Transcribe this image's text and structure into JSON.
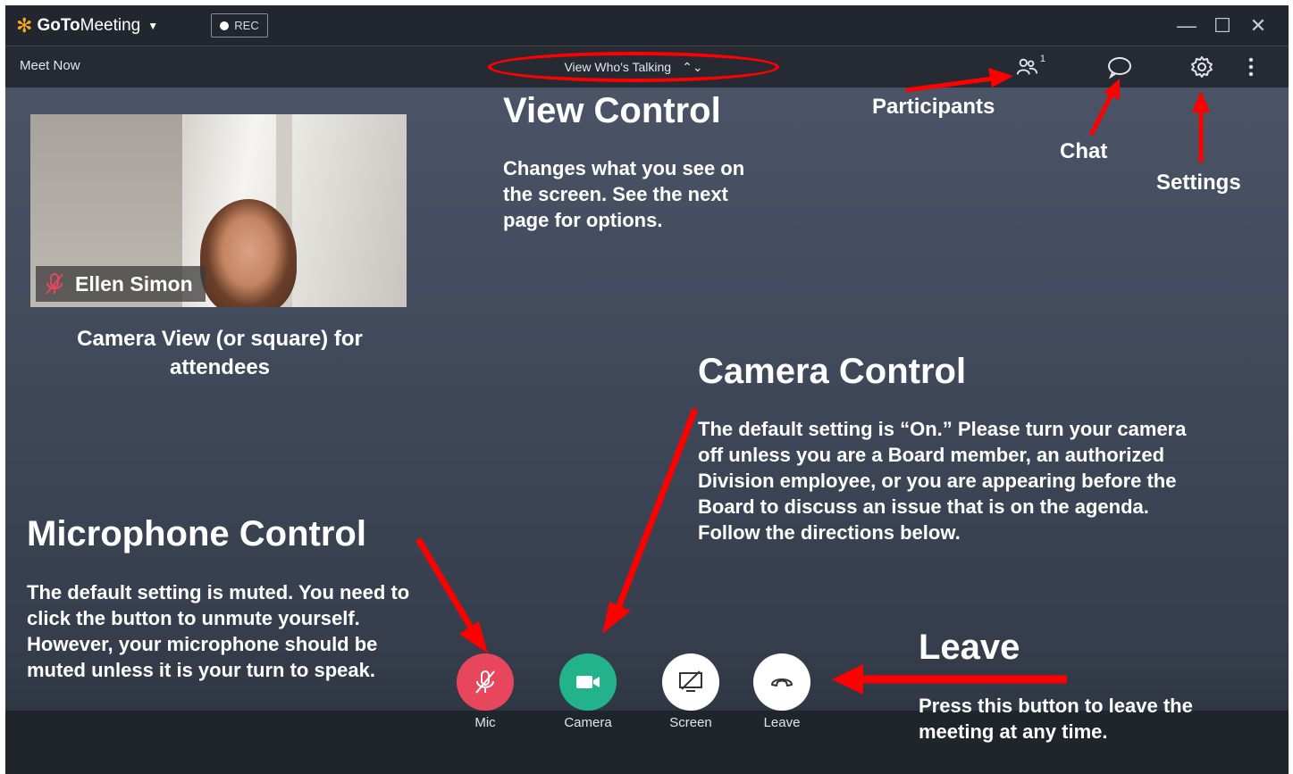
{
  "app": {
    "brand_bold": "GoTo",
    "brand_rest": "Meeting",
    "rec_label": "REC",
    "window_controls": [
      "—",
      "☐",
      "✕"
    ]
  },
  "toolbar": {
    "meet_now": "Meet Now",
    "view_selector": "View Who's Talking",
    "participant_count": "1",
    "icons": [
      "participants-icon",
      "chat-icon",
      "settings-icon",
      "more-icon"
    ]
  },
  "video": {
    "attendee_name": "Ellen Simon"
  },
  "controls": [
    {
      "label": "Mic",
      "color": "#e8465c"
    },
    {
      "label": "Camera",
      "color": "#22b38a"
    },
    {
      "label": "Screen",
      "color": "#ffffff"
    },
    {
      "label": "Leave",
      "color": "#ffffff"
    }
  ],
  "annotations": {
    "participants": "Participants",
    "chat": "Chat",
    "settings": "Settings",
    "view_title": "View Control",
    "view_body": "Changes what you see on the screen. See the next page for options.",
    "camera_view": "Camera View (or square) for attendees",
    "camera_title": "Camera Control",
    "camera_body": "The default setting is “On.” Please turn your camera off unless you are a Board member, an authorized Division employee, or you are appearing before the Board to discuss an issue that is on the agenda. Follow the directions below.",
    "mic_title": "Microphone Control",
    "mic_body": "The default setting is muted. You need to click the button to unmute yourself. However, your microphone should be muted unless it is your turn to speak.",
    "leave_title": "Leave",
    "leave_body": "Press this button to leave the meeting at any time."
  },
  "colors": {
    "annotation_red": "#ff0000",
    "background": "#3b4453",
    "titlebar": "#22262e"
  }
}
